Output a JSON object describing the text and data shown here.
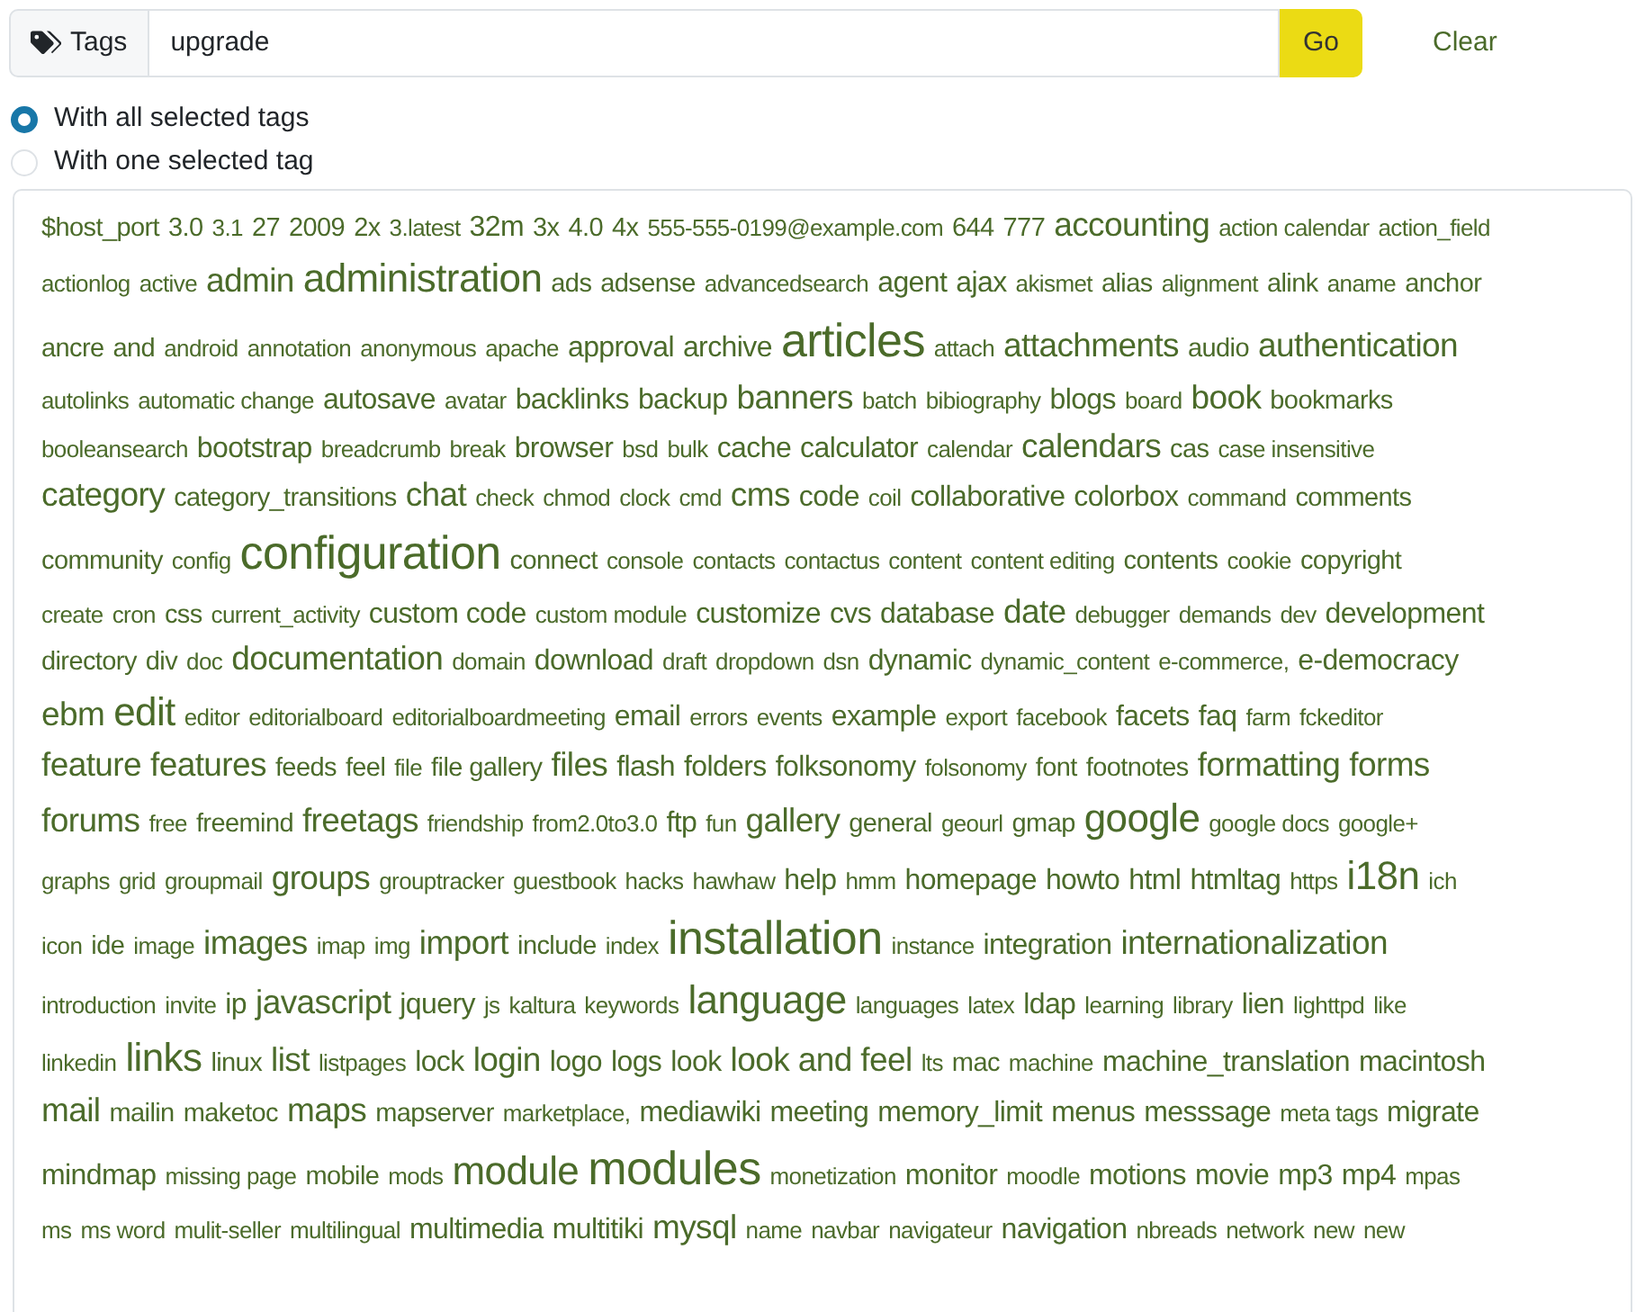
{
  "search": {
    "addon_label": "Tags",
    "value": "upgrade",
    "go_label": "Go",
    "clear_label": "Clear"
  },
  "match_modes": [
    {
      "label": "With all selected tags",
      "selected": true
    },
    {
      "label": "With one selected tag",
      "selected": false
    }
  ],
  "tag_rows": [
    [
      {
        "label": "$host_port",
        "kind": "s"
      },
      {
        "label": "3.0",
        "kind": "s"
      },
      {
        "label": "3.1",
        "kind": "xs"
      },
      {
        "label": "27",
        "kind": "s"
      },
      {
        "label": "2009",
        "kind": "s"
      },
      {
        "label": "2x",
        "kind": "s"
      },
      {
        "label": "3.latest",
        "kind": "xs"
      },
      {
        "label": "32m",
        "kind": "m"
      },
      {
        "label": "3x",
        "kind": "s"
      },
      {
        "label": "4.0",
        "kind": "s"
      },
      {
        "label": "4x",
        "kind": "s"
      },
      {
        "label": "555-555-0199@example.com",
        "kind": "xs"
      },
      {
        "label": "644",
        "kind": "s"
      },
      {
        "label": "777",
        "kind": "s"
      },
      {
        "label": "accounting",
        "kind": "l"
      },
      {
        "label": "action calendar",
        "kind": "xs"
      },
      {
        "label": "action_field",
        "kind": "xs"
      }
    ],
    [
      {
        "label": "actionlog",
        "kind": "xs"
      },
      {
        "label": "active",
        "kind": "xs"
      },
      {
        "label": "admin",
        "kind": "l"
      },
      {
        "label": "administration",
        "kind": "xl"
      },
      {
        "label": "ads",
        "kind": "s"
      },
      {
        "label": "adsense",
        "kind": "s"
      },
      {
        "label": "advancedsearch",
        "kind": "xs"
      },
      {
        "label": "agent",
        "kind": "m"
      },
      {
        "label": "ajax",
        "kind": "m"
      },
      {
        "label": "akismet",
        "kind": "xs"
      },
      {
        "label": "alias",
        "kind": "s"
      },
      {
        "label": "alignment",
        "kind": "xs"
      },
      {
        "label": "alink",
        "kind": "s"
      },
      {
        "label": "aname",
        "kind": "xs"
      },
      {
        "label": "anchor",
        "kind": "s"
      }
    ],
    [
      {
        "label": "ancre",
        "kind": "s"
      },
      {
        "label": "and",
        "kind": "s"
      },
      {
        "label": "android",
        "kind": "xs"
      },
      {
        "label": "annotation",
        "kind": "xs"
      },
      {
        "label": "anonymous",
        "kind": "xs"
      },
      {
        "label": "apache",
        "kind": "xs"
      },
      {
        "label": "approval",
        "kind": "m"
      },
      {
        "label": "archive",
        "kind": "m"
      },
      {
        "label": "articles",
        "kind": "xxl"
      },
      {
        "label": "attach",
        "kind": "xs"
      },
      {
        "label": "attachments",
        "kind": "l"
      },
      {
        "label": "audio",
        "kind": "s"
      },
      {
        "label": "authentication",
        "kind": "l"
      }
    ],
    [
      {
        "label": "autolinks",
        "kind": "xs"
      },
      {
        "label": "automatic change",
        "kind": "xs"
      },
      {
        "label": "autosave",
        "kind": "m"
      },
      {
        "label": "avatar",
        "kind": "xs"
      },
      {
        "label": "backlinks",
        "kind": "m"
      },
      {
        "label": "backup",
        "kind": "m"
      },
      {
        "label": "banners",
        "kind": "l"
      },
      {
        "label": "batch",
        "kind": "xs"
      },
      {
        "label": "bibiography",
        "kind": "xs"
      },
      {
        "label": "blogs",
        "kind": "m"
      },
      {
        "label": "board",
        "kind": "xs"
      },
      {
        "label": "book",
        "kind": "l"
      },
      {
        "label": "bookmarks",
        "kind": "s"
      }
    ],
    [
      {
        "label": "booleansearch",
        "kind": "xs"
      },
      {
        "label": "bootstrap",
        "kind": "m"
      },
      {
        "label": "breadcrumb",
        "kind": "xs"
      },
      {
        "label": "break",
        "kind": "xs"
      },
      {
        "label": "browser",
        "kind": "m"
      },
      {
        "label": "bsd",
        "kind": "xs"
      },
      {
        "label": "bulk",
        "kind": "xs"
      },
      {
        "label": "cache",
        "kind": "m"
      },
      {
        "label": "calculator",
        "kind": "m"
      },
      {
        "label": "calendar",
        "kind": "xs"
      },
      {
        "label": "calendars",
        "kind": "l"
      },
      {
        "label": "cas",
        "kind": "s"
      },
      {
        "label": "case insensitive",
        "kind": "xs"
      }
    ],
    [
      {
        "label": "category",
        "kind": "l"
      },
      {
        "label": "category_transitions",
        "kind": "s"
      },
      {
        "label": "chat",
        "kind": "l"
      },
      {
        "label": "check",
        "kind": "xs"
      },
      {
        "label": "chmod",
        "kind": "xs"
      },
      {
        "label": "clock",
        "kind": "xs"
      },
      {
        "label": "cmd",
        "kind": "xs"
      },
      {
        "label": "cms",
        "kind": "l"
      },
      {
        "label": "code",
        "kind": "m"
      },
      {
        "label": "coil",
        "kind": "xs"
      },
      {
        "label": "collaborative",
        "kind": "m"
      },
      {
        "label": "colorbox",
        "kind": "m"
      },
      {
        "label": "command",
        "kind": "xs"
      },
      {
        "label": "comments",
        "kind": "s"
      }
    ],
    [
      {
        "label": "community",
        "kind": "s"
      },
      {
        "label": "config",
        "kind": "xs"
      },
      {
        "label": "configuration",
        "kind": "xxl"
      },
      {
        "label": "connect",
        "kind": "s"
      },
      {
        "label": "console",
        "kind": "xs"
      },
      {
        "label": "contacts",
        "kind": "xs"
      },
      {
        "label": "contactus",
        "kind": "xs"
      },
      {
        "label": "content",
        "kind": "xs"
      },
      {
        "label": "content editing",
        "kind": "xs"
      },
      {
        "label": "contents",
        "kind": "s"
      },
      {
        "label": "cookie",
        "kind": "xs"
      },
      {
        "label": "copyright",
        "kind": "s"
      }
    ],
    [
      {
        "label": "create",
        "kind": "xs"
      },
      {
        "label": "cron",
        "kind": "xs"
      },
      {
        "label": "css",
        "kind": "s"
      },
      {
        "label": "current_activity",
        "kind": "xs"
      },
      {
        "label": "custom code",
        "kind": "m"
      },
      {
        "label": "custom module",
        "kind": "xs"
      },
      {
        "label": "customize",
        "kind": "m"
      },
      {
        "label": "cvs",
        "kind": "m"
      },
      {
        "label": "database",
        "kind": "m"
      },
      {
        "label": "date",
        "kind": "l"
      },
      {
        "label": "debugger",
        "kind": "xs"
      },
      {
        "label": "demands",
        "kind": "xs"
      },
      {
        "label": "dev",
        "kind": "xs"
      },
      {
        "label": "development",
        "kind": "m"
      }
    ],
    [
      {
        "label": "directory",
        "kind": "s"
      },
      {
        "label": "div",
        "kind": "s"
      },
      {
        "label": "doc",
        "kind": "xs"
      },
      {
        "label": "documentation",
        "kind": "l"
      },
      {
        "label": "domain",
        "kind": "xs"
      },
      {
        "label": "download",
        "kind": "m"
      },
      {
        "label": "draft",
        "kind": "xs"
      },
      {
        "label": "dropdown",
        "kind": "xs"
      },
      {
        "label": "dsn",
        "kind": "xs"
      },
      {
        "label": "dynamic",
        "kind": "m"
      },
      {
        "label": "dynamic_content",
        "kind": "xs"
      },
      {
        "label": "e-commerce,",
        "kind": "xs"
      },
      {
        "label": "e-democracy",
        "kind": "m"
      }
    ],
    [
      {
        "label": "ebm",
        "kind": "l"
      },
      {
        "label": "edit",
        "kind": "xl"
      },
      {
        "label": "editor",
        "kind": "xs"
      },
      {
        "label": "editorialboard",
        "kind": "xs"
      },
      {
        "label": "editorialboardmeeting",
        "kind": "xs"
      },
      {
        "label": "email",
        "kind": "m"
      },
      {
        "label": "errors",
        "kind": "xs"
      },
      {
        "label": "events",
        "kind": "xs"
      },
      {
        "label": "example",
        "kind": "m"
      },
      {
        "label": "export",
        "kind": "xs"
      },
      {
        "label": "facebook",
        "kind": "xs"
      },
      {
        "label": "facets",
        "kind": "m"
      },
      {
        "label": "faq",
        "kind": "m"
      },
      {
        "label": "farm",
        "kind": "xs"
      },
      {
        "label": "fckeditor",
        "kind": "xs"
      }
    ],
    [
      {
        "label": "feature",
        "kind": "l"
      },
      {
        "label": "features",
        "kind": "l"
      },
      {
        "label": "feeds",
        "kind": "s"
      },
      {
        "label": "feel",
        "kind": "s"
      },
      {
        "label": "file",
        "kind": "xs"
      },
      {
        "label": "file gallery",
        "kind": "s"
      },
      {
        "label": "files",
        "kind": "l"
      },
      {
        "label": "flash",
        "kind": "m"
      },
      {
        "label": "folders",
        "kind": "m"
      },
      {
        "label": "folksonomy",
        "kind": "m"
      },
      {
        "label": "folsonomy",
        "kind": "xs"
      },
      {
        "label": "font",
        "kind": "s"
      },
      {
        "label": "footnotes",
        "kind": "s"
      },
      {
        "label": "formatting",
        "kind": "l"
      },
      {
        "label": "forms",
        "kind": "l"
      }
    ],
    [
      {
        "label": "forums",
        "kind": "l"
      },
      {
        "label": "free",
        "kind": "xs"
      },
      {
        "label": "freemind",
        "kind": "s"
      },
      {
        "label": "freetags",
        "kind": "l"
      },
      {
        "label": "friendship",
        "kind": "xs"
      },
      {
        "label": "from2.0to3.0",
        "kind": "xs"
      },
      {
        "label": "ftp",
        "kind": "m"
      },
      {
        "label": "fun",
        "kind": "xs"
      },
      {
        "label": "gallery",
        "kind": "l"
      },
      {
        "label": "general",
        "kind": "s"
      },
      {
        "label": "geourl",
        "kind": "xs"
      },
      {
        "label": "gmap",
        "kind": "s"
      },
      {
        "label": "google",
        "kind": "xl"
      },
      {
        "label": "google docs",
        "kind": "xs"
      },
      {
        "label": "google+",
        "kind": "xs"
      }
    ],
    [
      {
        "label": "graphs",
        "kind": "xs"
      },
      {
        "label": "grid",
        "kind": "xs"
      },
      {
        "label": "groupmail",
        "kind": "xs"
      },
      {
        "label": "groups",
        "kind": "l"
      },
      {
        "label": "grouptracker",
        "kind": "xs"
      },
      {
        "label": "guestbook",
        "kind": "xs"
      },
      {
        "label": "hacks",
        "kind": "xs"
      },
      {
        "label": "hawhaw",
        "kind": "xs"
      },
      {
        "label": "help",
        "kind": "m"
      },
      {
        "label": "hmm",
        "kind": "xs"
      },
      {
        "label": "homepage",
        "kind": "m"
      },
      {
        "label": "howto",
        "kind": "m"
      },
      {
        "label": "html",
        "kind": "m"
      },
      {
        "label": "htmltag",
        "kind": "m"
      },
      {
        "label": "https",
        "kind": "xs"
      },
      {
        "label": "i18n",
        "kind": "xl"
      },
      {
        "label": "ich",
        "kind": "xs"
      }
    ],
    [
      {
        "label": "icon",
        "kind": "xs"
      },
      {
        "label": "ide",
        "kind": "s"
      },
      {
        "label": "image",
        "kind": "xs"
      },
      {
        "label": "images",
        "kind": "l"
      },
      {
        "label": "imap",
        "kind": "xs"
      },
      {
        "label": "img",
        "kind": "xs"
      },
      {
        "label": "import",
        "kind": "l"
      },
      {
        "label": "include",
        "kind": "s"
      },
      {
        "label": "index",
        "kind": "xs"
      },
      {
        "label": "installation",
        "kind": "xxl"
      },
      {
        "label": "instance",
        "kind": "xs"
      },
      {
        "label": "integration",
        "kind": "m"
      },
      {
        "label": "internationalization",
        "kind": "l"
      }
    ],
    [
      {
        "label": "introduction",
        "kind": "xs"
      },
      {
        "label": "invite",
        "kind": "xs"
      },
      {
        "label": "ip",
        "kind": "m"
      },
      {
        "label": "javascript",
        "kind": "l"
      },
      {
        "label": "jquery",
        "kind": "m"
      },
      {
        "label": "js",
        "kind": "xs"
      },
      {
        "label": "kaltura",
        "kind": "xs"
      },
      {
        "label": "keywords",
        "kind": "xs"
      },
      {
        "label": "language",
        "kind": "xl"
      },
      {
        "label": "languages",
        "kind": "xs"
      },
      {
        "label": "latex",
        "kind": "xs"
      },
      {
        "label": "ldap",
        "kind": "m"
      },
      {
        "label": "learning",
        "kind": "xs"
      },
      {
        "label": "library",
        "kind": "xs"
      },
      {
        "label": "lien",
        "kind": "m"
      },
      {
        "label": "lighttpd",
        "kind": "xs"
      },
      {
        "label": "like",
        "kind": "xs"
      }
    ],
    [
      {
        "label": "linkedin",
        "kind": "xs"
      },
      {
        "label": "links",
        "kind": "xl"
      },
      {
        "label": "linux",
        "kind": "s"
      },
      {
        "label": "list",
        "kind": "l"
      },
      {
        "label": "listpages",
        "kind": "xs"
      },
      {
        "label": "lock",
        "kind": "m"
      },
      {
        "label": "login",
        "kind": "l"
      },
      {
        "label": "logo",
        "kind": "m"
      },
      {
        "label": "logs",
        "kind": "m"
      },
      {
        "label": "look",
        "kind": "m"
      },
      {
        "label": "look and feel",
        "kind": "l"
      },
      {
        "label": "lts",
        "kind": "xs"
      },
      {
        "label": "mac",
        "kind": "s"
      },
      {
        "label": "machine",
        "kind": "xs"
      },
      {
        "label": "machine_translation",
        "kind": "m"
      },
      {
        "label": "macintosh",
        "kind": "m"
      }
    ],
    [
      {
        "label": "mail",
        "kind": "l"
      },
      {
        "label": "mailin",
        "kind": "s"
      },
      {
        "label": "maketoc",
        "kind": "s"
      },
      {
        "label": "maps",
        "kind": "l"
      },
      {
        "label": "mapserver",
        "kind": "s"
      },
      {
        "label": "marketplace,",
        "kind": "xs"
      },
      {
        "label": "mediawiki",
        "kind": "m"
      },
      {
        "label": "meeting",
        "kind": "m"
      },
      {
        "label": "memory_limit",
        "kind": "m"
      },
      {
        "label": "menus",
        "kind": "m"
      },
      {
        "label": "messsage",
        "kind": "m"
      },
      {
        "label": "meta tags",
        "kind": "xs"
      },
      {
        "label": "migrate",
        "kind": "m"
      }
    ],
    [
      {
        "label": "mindmap",
        "kind": "m"
      },
      {
        "label": "missing page",
        "kind": "xs"
      },
      {
        "label": "mobile",
        "kind": "s"
      },
      {
        "label": "mods",
        "kind": "xs"
      },
      {
        "label": "module",
        "kind": "xl"
      },
      {
        "label": "modules",
        "kind": "xxl"
      },
      {
        "label": "monetization",
        "kind": "xs"
      },
      {
        "label": "monitor",
        "kind": "m"
      },
      {
        "label": "moodle",
        "kind": "xs"
      },
      {
        "label": "motions",
        "kind": "m"
      },
      {
        "label": "movie",
        "kind": "m"
      },
      {
        "label": "mp3",
        "kind": "m"
      },
      {
        "label": "mp4",
        "kind": "m"
      },
      {
        "label": "mpas",
        "kind": "xs"
      }
    ],
    [
      {
        "label": "ms",
        "kind": "xs"
      },
      {
        "label": "ms word",
        "kind": "xs"
      },
      {
        "label": "mulit-seller",
        "kind": "xs"
      },
      {
        "label": "multilingual",
        "kind": "xs"
      },
      {
        "label": "multimedia",
        "kind": "m"
      },
      {
        "label": "multitiki",
        "kind": "m"
      },
      {
        "label": "mysql",
        "kind": "l"
      },
      {
        "label": "name",
        "kind": "xs"
      },
      {
        "label": "navbar",
        "kind": "xs"
      },
      {
        "label": "navigateur",
        "kind": "xs"
      },
      {
        "label": "navigation",
        "kind": "m"
      },
      {
        "label": "nbreads",
        "kind": "xs"
      },
      {
        "label": "network",
        "kind": "xs"
      },
      {
        "label": "new",
        "kind": "xs"
      },
      {
        "label": "new",
        "kind": "xs"
      }
    ]
  ]
}
